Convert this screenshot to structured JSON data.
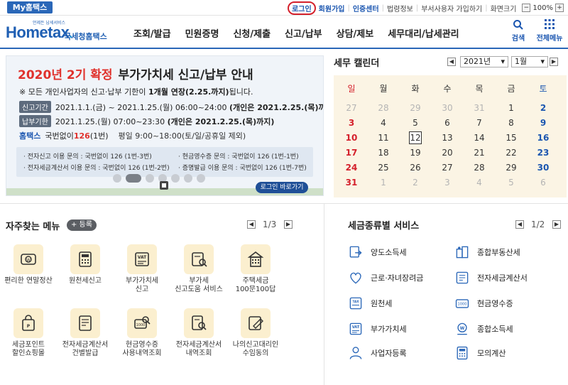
{
  "topbar": {
    "my_hometax": "My홈택스",
    "links": [
      {
        "label": "로그인",
        "key": "login"
      },
      {
        "label": "회원가입",
        "key": "signup"
      },
      {
        "label": "인증센터",
        "key": "cert"
      },
      {
        "label": "법령정보",
        "key": "law"
      },
      {
        "label": "부서사용자 가입하기",
        "key": "dept"
      },
      {
        "label": "화면크기",
        "key": "size"
      }
    ],
    "zoom_minus": "−",
    "zoom_value": "100%",
    "zoom_plus": "+"
  },
  "header": {
    "logo_small": "언제든 납세서비스",
    "logo_main": "Hometax",
    "logo_tld": ".",
    "logo_sub": "국세청홈택스",
    "nav": [
      "조회/발급",
      "민원증명",
      "신청/제출",
      "신고/납부",
      "상담/제보",
      "세무대리/납세관리"
    ],
    "search_label": "검색",
    "allmenu_label": "전체메뉴"
  },
  "banner": {
    "title_red": "2020년 2기 확정",
    "title_dark": "부가가치세 신고/납부 안내",
    "note_pre": "※ 모든 개인사업자의 신고·납부 기한이 ",
    "note_bold": "1개월 연장(2.25.까지)",
    "note_post": "됩니다.",
    "row1_pill": "신고기간",
    "row1_text": "2021.1.1.(금) ~ 2021.1.25.(월) 06:00~24:00 ",
    "row1_bold": "(개인은 2021.2.25.(목)까지)",
    "row2_pill": "납부기한",
    "row2_text": "2021.1.25.(월) 07:00~23:30 ",
    "row2_bold": "(개인은 2021.2.25.(목)까지)",
    "row3_blue": "홈택스",
    "row3_text": "국번없이 ",
    "row3_red": "126",
    "row3_text2": "(1번)",
    "row3_gray": "평일 9:00~18:00(토/일/공휴일 제외)",
    "info": [
      "· 전자신고 이용 문의 : 국번없이 126 (1번-3번)",
      "· 현금영수증 문의 : 국번없이 126 (1번-1번)",
      "· 전자세금계산서 이용 문의 : 국번없이 126 (1번-2번)",
      "· 증명발급 이용 문의 : 국번없이 126 (1번-7번)"
    ],
    "login_button": "로그인 바로가기"
  },
  "calendar": {
    "title": "세무 캘린더",
    "year": "2021년",
    "month": "1월",
    "weekdays": [
      "일",
      "월",
      "화",
      "수",
      "목",
      "금",
      "토"
    ],
    "weeks": [
      [
        [
          "27",
          "o"
        ],
        [
          "28",
          "o"
        ],
        [
          "29",
          "o"
        ],
        [
          "30",
          "o"
        ],
        [
          "31",
          "o"
        ],
        [
          "1",
          "n"
        ],
        [
          "2",
          "n"
        ]
      ],
      [
        [
          "3",
          "n"
        ],
        [
          "4",
          "n"
        ],
        [
          "5",
          "n"
        ],
        [
          "6",
          "n"
        ],
        [
          "7",
          "n"
        ],
        [
          "8",
          "n"
        ],
        [
          "9",
          "n"
        ]
      ],
      [
        [
          "10",
          "n"
        ],
        [
          "11",
          "n"
        ],
        [
          "12",
          "t"
        ],
        [
          "13",
          "n"
        ],
        [
          "14",
          "n"
        ],
        [
          "15",
          "n"
        ],
        [
          "16",
          "n"
        ]
      ],
      [
        [
          "17",
          "n"
        ],
        [
          "18",
          "n"
        ],
        [
          "19",
          "n"
        ],
        [
          "20",
          "n"
        ],
        [
          "21",
          "n"
        ],
        [
          "22",
          "n"
        ],
        [
          "23",
          "n"
        ]
      ],
      [
        [
          "24",
          "n"
        ],
        [
          "25",
          "n"
        ],
        [
          "26",
          "n"
        ],
        [
          "27",
          "n"
        ],
        [
          "28",
          "n"
        ],
        [
          "29",
          "n"
        ],
        [
          "30",
          "n"
        ]
      ],
      [
        [
          "31",
          "n"
        ],
        [
          "1",
          "o"
        ],
        [
          "2",
          "o"
        ],
        [
          "3",
          "o"
        ],
        [
          "4",
          "o"
        ],
        [
          "5",
          "o"
        ],
        [
          "6",
          "o"
        ]
      ]
    ],
    "colors": {
      "sunday": "#d4202b",
      "saturday": "#1b56b0",
      "normal": "#333333",
      "other": "#b4b4b4"
    }
  },
  "favorites": {
    "title": "자주찾는 메뉴",
    "register": "+ 등록",
    "page": "1/3",
    "items": [
      {
        "label": "편리한 연말정산",
        "icon": "coin-icon"
      },
      {
        "label": "원천세신고",
        "icon": "calculator-icon"
      },
      {
        "label": "부가가치세\n신고",
        "icon": "vat-icon"
      },
      {
        "label": "부가세\n신고도움 서비스",
        "icon": "help-document-icon"
      },
      {
        "label": "주택세금\n100문100답",
        "icon": "building-icon"
      },
      {
        "label": "세금포인트\n할인쇼핑몰",
        "icon": "shopping-bag-icon"
      },
      {
        "label": "전자세금계산서\n건별발급",
        "icon": "invoice-icon"
      },
      {
        "label": "현금영수증\n사용내역조회",
        "icon": "receipt-search-icon"
      },
      {
        "label": "전자세금계산서\n내역조회",
        "icon": "invoice-search-icon"
      },
      {
        "label": "나의신고대리인\n수임동의",
        "icon": "agent-icon"
      }
    ]
  },
  "tax_services": {
    "title": "세금종류별 서비스",
    "page": "1/2",
    "items": [
      {
        "label": "양도소득세",
        "icon": "transfer-tax-icon"
      },
      {
        "label": "종합부동산세",
        "icon": "property-tax-icon"
      },
      {
        "label": "근로·자녀장려금",
        "icon": "heart-icon"
      },
      {
        "label": "전자세금계산서",
        "icon": "e-invoice-icon"
      },
      {
        "label": "원천세",
        "icon": "withholding-icon"
      },
      {
        "label": "현금영수증",
        "icon": "cash-receipt-icon"
      },
      {
        "label": "부가가치세",
        "icon": "vat-icon"
      },
      {
        "label": "종합소득세",
        "icon": "income-tax-icon"
      },
      {
        "label": "사업자등록",
        "icon": "person-icon"
      },
      {
        "label": "모의계산",
        "icon": "calculator-icon"
      }
    ]
  }
}
